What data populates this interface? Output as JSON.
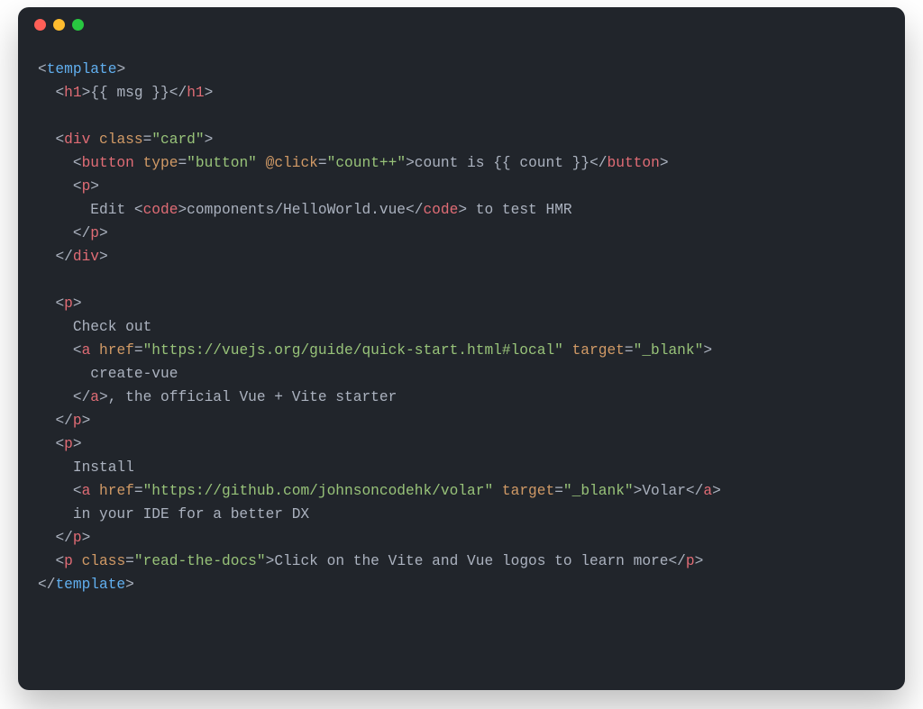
{
  "code": {
    "l01": {
      "tag": "template"
    },
    "l02": {
      "tag": "h1",
      "expr": "{{ msg }}"
    },
    "l03": {
      "tag": "div",
      "attr_class": "class",
      "val_class": "\"card\""
    },
    "l04": {
      "tag": "button",
      "attr_type": "type",
      "val_type": "\"button\"",
      "attr_click": "@click",
      "val_click": "\"count++\"",
      "text": "count is {{ count }}"
    },
    "l05": {
      "tag": "p"
    },
    "l06": {
      "text_a": "Edit ",
      "tag": "code",
      "text_b": "components/HelloWorld.vue",
      "text_c": " to test HMR"
    },
    "l07": {
      "tag": "p"
    },
    "l08": {
      "tag": "div"
    },
    "l09": {
      "tag": "p"
    },
    "l10": {
      "text": "Check out"
    },
    "l11": {
      "tag": "a",
      "attr_href": "href",
      "val_href": "\"https://vuejs.org/guide/quick-start.html#local\"",
      "attr_target": "target",
      "val_target": "\"_blank\""
    },
    "l12": {
      "text": "create-vue"
    },
    "l13": {
      "tag": "a",
      "text": ", the official Vue + Vite starter"
    },
    "l14": {
      "tag": "p"
    },
    "l15": {
      "tag": "p"
    },
    "l16": {
      "text": "Install"
    },
    "l17": {
      "tag": "a",
      "attr_href": "href",
      "val_href": "\"https://github.com/johnsoncodehk/volar\"",
      "attr_target": "target",
      "val_target": "\"_blank\"",
      "text": "Volar"
    },
    "l18": {
      "text": "in your IDE for a better DX"
    },
    "l19": {
      "tag": "p"
    },
    "l20": {
      "tag": "p",
      "attr_class": "class",
      "val_class": "\"read-the-docs\"",
      "text": "Click on the Vite and Vue logos to learn more"
    },
    "l21": {
      "tag": "template"
    }
  }
}
